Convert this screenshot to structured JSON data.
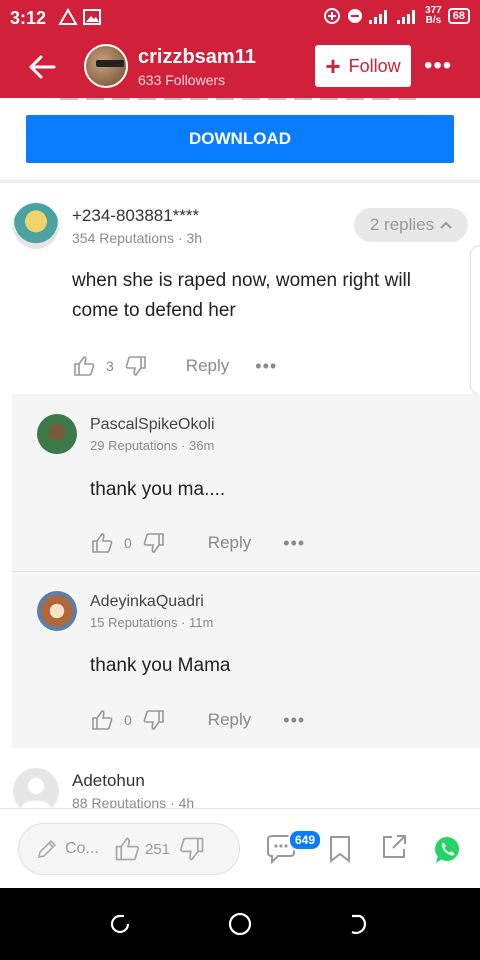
{
  "status_bar": {
    "time": "3:12",
    "network_speed_top": "377",
    "network_speed_bottom": "B/s",
    "battery": "68"
  },
  "header": {
    "username": "crizzbsam11",
    "followers": "633 Followers",
    "follow_label": "Follow"
  },
  "download": {
    "label": "DOWNLOAD"
  },
  "comments": [
    {
      "name": "+234-803881****",
      "meta": "354 Reputations · 3h",
      "text": "when she is raped now, women right will come to defend her",
      "likes": "3",
      "reply_label": "Reply",
      "replies_label": "2 replies"
    },
    {
      "name": "PascalSpikeOkoli",
      "meta": "29 Reputations · 36m",
      "text": "thank you ma....",
      "likes": "0",
      "reply_label": "Reply"
    },
    {
      "name": "AdeyinkaQuadri",
      "meta": "15 Reputations · 11m",
      "text": "thank you Mama",
      "likes": "0",
      "reply_label": "Reply"
    },
    {
      "name": "Adetohun",
      "meta": "88 Reputations · 4h"
    }
  ],
  "bottom_bar": {
    "composer_placeholder": "Co...",
    "likes": "251",
    "comment_count": "649"
  },
  "colors": {
    "brand": "#d0203a",
    "download": "#0a7cff",
    "whatsapp": "#25d366"
  }
}
